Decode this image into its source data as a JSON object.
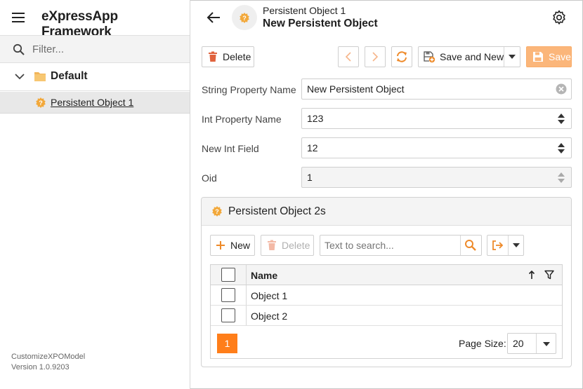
{
  "app": {
    "title": "eXpressApp Framework"
  },
  "navigation": {
    "filter_placeholder": "Filter...",
    "group": {
      "label": "Default"
    },
    "items": [
      {
        "label": "Persistent Object 1",
        "selected": true
      }
    ],
    "version_lines": [
      "CustomizeXPOModel",
      "Version 1.0.9203"
    ]
  },
  "header": {
    "caption": "Persistent Object 1",
    "title": "New Persistent Object"
  },
  "toolbar": {
    "delete_label": "Delete",
    "save_and_new_label": "Save and New",
    "save_label": "Save"
  },
  "form": {
    "fields": [
      {
        "label": "String Property Name",
        "value": "New Persistent Object"
      },
      {
        "label": "Int Property Name",
        "value": "123"
      },
      {
        "label": "New Int Field",
        "value": "12"
      },
      {
        "label": "Oid",
        "value": "1"
      }
    ]
  },
  "nested_list": {
    "title": "Persistent Object 2s",
    "new_label": "New",
    "delete_label": "Delete",
    "search_placeholder": "Text to search...",
    "column_name": "Name",
    "rows": [
      {
        "name": "Object 1"
      },
      {
        "name": "Object 2"
      }
    ],
    "page": "1",
    "page_size_label": "Page Size:",
    "page_size": "20"
  },
  "colors": {
    "accent": "#ff7e1a",
    "save_disabled": "#fbb67a",
    "object_icon": "#f0a030"
  }
}
